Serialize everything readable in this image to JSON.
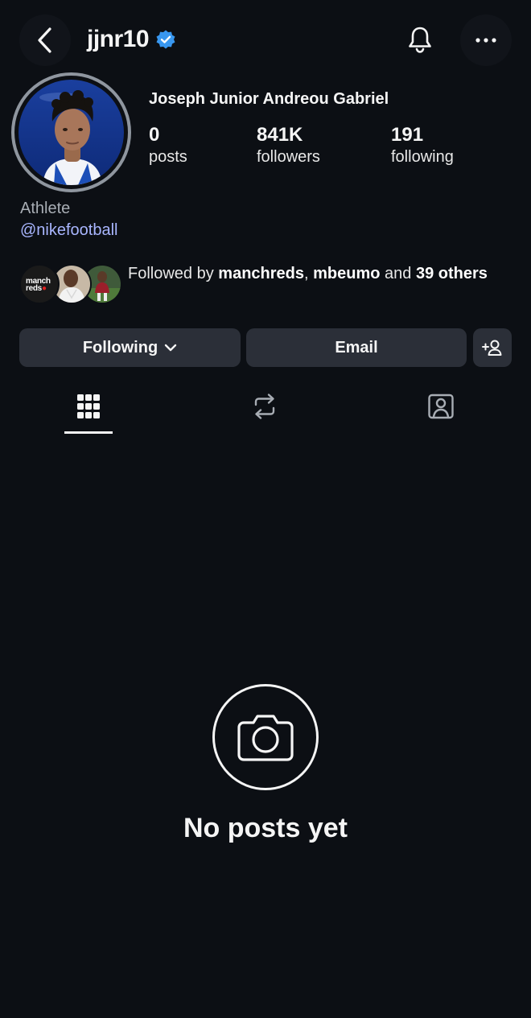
{
  "header": {
    "username": "jjnr10",
    "back_icon": "chevron-left-icon",
    "verified_icon": "verified-badge-icon",
    "bell_icon": "bell-icon",
    "more_icon": "more-horizontal-icon"
  },
  "profile": {
    "full_name": "Joseph Junior Andreou Gabriel",
    "stats": [
      {
        "value": "0",
        "label": "posts"
      },
      {
        "value": "841K",
        "label": "followers"
      },
      {
        "value": "191",
        "label": "following"
      }
    ],
    "category": "Athlete",
    "link": "@nikefootball"
  },
  "followed_by": {
    "prefix": "Followed by ",
    "user1": "manchreds",
    "sep": ", ",
    "user2": "mbeumo",
    "and": " and ",
    "others": "39 others",
    "logo_text_line1": "manch",
    "logo_text_line2": "reds"
  },
  "actions": {
    "following_label": "Following",
    "email_label": "Email",
    "add_user_icon": "add-user-icon"
  },
  "tabs": {
    "grid_icon": "grid-icon",
    "reposts_icon": "repost-icon",
    "tagged_icon": "tagged-user-icon"
  },
  "empty": {
    "icon": "camera-icon",
    "title": "No posts yet"
  },
  "colors": {
    "background": "#0c0f14",
    "button": "#2b2f38",
    "link": "#a9b6ff",
    "verified": "#3897f0"
  }
}
